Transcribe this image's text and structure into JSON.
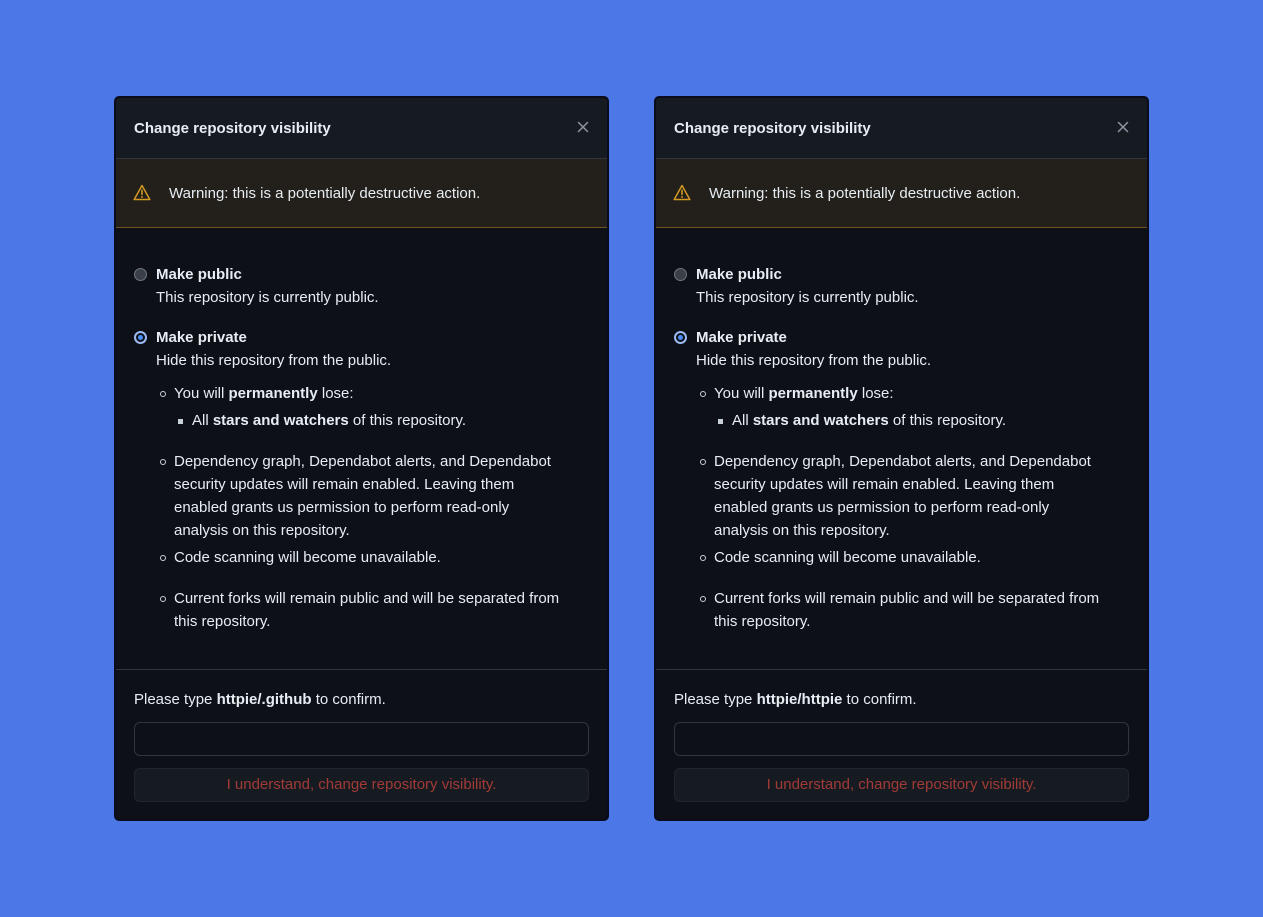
{
  "colors": {
    "background": "#4b78e6",
    "dialog_bg": "#0d1117",
    "header_bg": "#161b22",
    "warning_bg": "#231f1a",
    "warning_icon": "#d29922",
    "danger_text": "#a13a36",
    "radio_selected": "#4b8ef7"
  },
  "dialogs": [
    {
      "title": "Change repository visibility",
      "close_icon": "close-icon",
      "warning": {
        "icon": "alert-triangle-icon",
        "text": "Warning: this is a potentially destructive action."
      },
      "options": [
        {
          "label": "Make public",
          "description": "This repository is currently public.",
          "selected": false
        },
        {
          "label": "Make private",
          "description": "Hide this repository from the public.",
          "selected": true
        }
      ],
      "consequences": {
        "lose_prefix": "You will ",
        "lose_bold": "permanently",
        "lose_suffix": " lose:",
        "stars_prefix": "All ",
        "stars_bold": "stars and watchers",
        "stars_suffix": " of this repository.",
        "dependency_line1": "Dependency graph, Dependabot alerts, and Dependabot",
        "dependency_line2": "security updates will remain enabled. Leaving them",
        "dependency_line3": "enabled grants us permission to perform read-only",
        "dependency_line4": "analysis on this repository.",
        "code_scanning": "Code scanning will become unavailable.",
        "forks_line1": "Current forks will remain public and will be separated from",
        "forks_line2": "this repository."
      },
      "confirm": {
        "prefix": "Please type ",
        "repo": "httpie/.github",
        "suffix": " to confirm.",
        "input_value": "",
        "button_label": "I understand, change repository visibility."
      }
    },
    {
      "title": "Change repository visibility",
      "close_icon": "close-icon",
      "warning": {
        "icon": "alert-triangle-icon",
        "text": "Warning: this is a potentially destructive action."
      },
      "options": [
        {
          "label": "Make public",
          "description": "This repository is currently public.",
          "selected": false
        },
        {
          "label": "Make private",
          "description": "Hide this repository from the public.",
          "selected": true
        }
      ],
      "consequences": {
        "lose_prefix": "You will ",
        "lose_bold": "permanently",
        "lose_suffix": " lose:",
        "stars_prefix": "All ",
        "stars_bold": "stars and watchers",
        "stars_suffix": " of this repository.",
        "dependency_line1": "Dependency graph, Dependabot alerts, and Dependabot",
        "dependency_line2": "security updates will remain enabled. Leaving them",
        "dependency_line3": "enabled grants us permission to perform read-only",
        "dependency_line4": "analysis on this repository.",
        "code_scanning": "Code scanning will become unavailable.",
        "forks_line1": "Current forks will remain public and will be separated from",
        "forks_line2": "this repository."
      },
      "confirm": {
        "prefix": "Please type ",
        "repo": "httpie/httpie",
        "suffix": " to confirm.",
        "input_value": "",
        "button_label": "I understand, change repository visibility."
      }
    }
  ]
}
